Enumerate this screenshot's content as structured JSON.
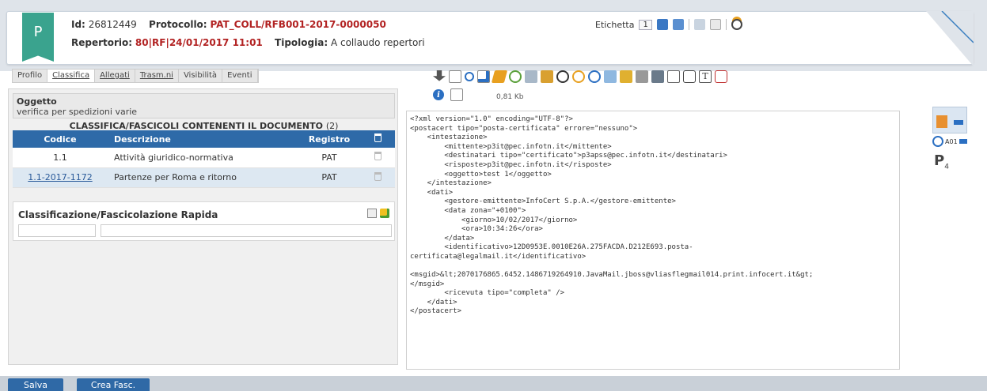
{
  "header": {
    "badge": "P",
    "id_label": "Id:",
    "id_value": "26812449",
    "protocollo_label": "Protocollo:",
    "protocollo_value": "PAT_COLL/RFB001-2017-0000050",
    "repertorio_label": "Repertorio:",
    "repertorio_value": "80|RF|24/01/2017 11:01",
    "tipologia_label": "Tipologia:",
    "tipologia_value": "A collaudo repertori",
    "etichetta_label": "Etichetta",
    "etichetta_value": "1"
  },
  "tabs": [
    {
      "label": "Profilo"
    },
    {
      "label": "Classifica"
    },
    {
      "label": "Allegati"
    },
    {
      "label": "Trasm.ni"
    },
    {
      "label": "Visibilità"
    },
    {
      "label": "Eventi"
    }
  ],
  "oggetto": {
    "title": "Oggetto",
    "text": "verifica per spedizioni varie"
  },
  "classifica": {
    "title": "CLASSIFICA/FASCICOLI CONTENENTI IL DOCUMENTO",
    "count": "(2)",
    "columns": [
      "Codice",
      "Descrizione",
      "Registro"
    ],
    "rows": [
      {
        "codice": "1.1",
        "descrizione": "Attività giuridico-normativa",
        "registro": "PAT"
      },
      {
        "codice": "1.1-2017-1172",
        "descrizione": "Partenze per Roma e ritorno",
        "registro": "PAT"
      }
    ]
  },
  "rapida": {
    "title": "Classificazione/Fascicolazione Rapida",
    "code_value": "",
    "desc_value": ""
  },
  "file_size": "0,81 Kb",
  "xml_lines": [
    "<?xml version=\"1.0\" encoding=\"UTF-8\"?>",
    "<postacert tipo=\"posta-certificata\" errore=\"nessuno\">",
    "    <intestazione>",
    "        <mittente>p3it@pec.infotn.it</mittente>",
    "        <destinatari tipo=\"certificato\">p3apss@pec.infotn.it</destinatari>",
    "        <risposte>p3it@pec.infotn.it</risposte>",
    "        <oggetto>test 1</oggetto>",
    "    </intestazione>",
    "    <dati>",
    "        <gestore-emittente>InfoCert S.p.A.</gestore-emittente>",
    "        <data zona=\"+0100\">",
    "            <giorno>10/02/2017</giorno>",
    "            <ora>10:34:26</ora>",
    "        </data>",
    "        <identificativo>12D0953E.0010E26A.275FACDA.D212E693.posta-",
    "certificata@legalmail.it</identificativo>",
    "",
    "<msgid>&lt;2070176865.6452.1486719264910.JavaMail.jboss@vliasflegmail014.print.infocert.it&gt;",
    "</msgid>",
    "        <ricevuta tipo=\"completa\" />",
    "    </dati>",
    "</postacert>"
  ],
  "side": {
    "attachment_label": "A01",
    "protocol_count": "4"
  },
  "buttons": {
    "save": "Salva",
    "create_folder": "Crea Fasc."
  },
  "colors": {
    "badge": "#3aa38e",
    "table_header": "#2e6aa8",
    "button": "#2f69a6",
    "protocol_red": "#b22222"
  }
}
